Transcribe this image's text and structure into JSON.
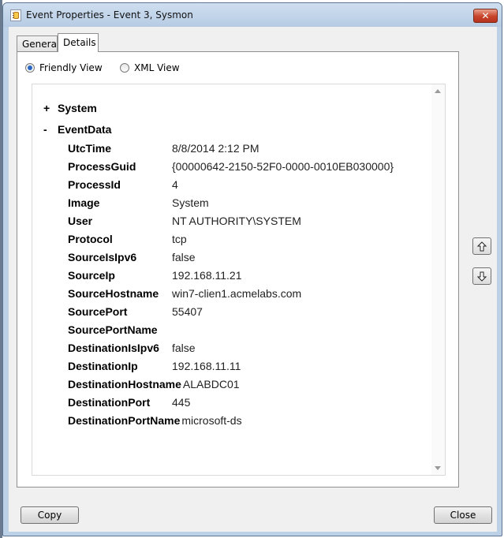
{
  "window": {
    "title": "Event Properties - Event 3, Sysmon",
    "close_glyph": "✕"
  },
  "tabs": [
    {
      "label": "General",
      "active": false
    },
    {
      "label": "Details",
      "active": true
    }
  ],
  "view_options": {
    "friendly": {
      "label": "Friendly View",
      "selected": true
    },
    "xml": {
      "label": "XML View",
      "selected": false
    }
  },
  "tree": {
    "system": {
      "marker": "+",
      "label": "System"
    },
    "eventdata": {
      "marker": "-",
      "label": "EventData"
    }
  },
  "fields": [
    {
      "name": "UtcTime",
      "value": "8/8/2014 2:12 PM"
    },
    {
      "name": "ProcessGuid",
      "value": "{00000642-2150-52F0-0000-0010EB030000}"
    },
    {
      "name": "ProcessId",
      "value": "4"
    },
    {
      "name": "Image",
      "value": "System"
    },
    {
      "name": "User",
      "value": "NT AUTHORITY\\SYSTEM"
    },
    {
      "name": "Protocol",
      "value": "tcp"
    },
    {
      "name": "SourceIsIpv6",
      "value": "false"
    },
    {
      "name": "SourceIp",
      "value": "192.168.11.21"
    },
    {
      "name": "SourceHostname",
      "value": "win7-clien1.acmelabs.com"
    },
    {
      "name": "SourcePort",
      "value": "55407"
    },
    {
      "name": "SourcePortName",
      "value": ""
    },
    {
      "name": "DestinationIsIpv6",
      "value": "false"
    },
    {
      "name": "DestinationIp",
      "value": "192.168.11.11"
    },
    {
      "name": "DestinationHostname",
      "value": "ALABDC01"
    },
    {
      "name": "DestinationPort",
      "value": "445"
    },
    {
      "name": "DestinationPortName",
      "value": "microsoft-ds"
    }
  ],
  "buttons": {
    "copy": "Copy",
    "close": "Close"
  },
  "colors": {
    "selected_radio": "#2a67c2",
    "close_button": "#c7432a"
  }
}
